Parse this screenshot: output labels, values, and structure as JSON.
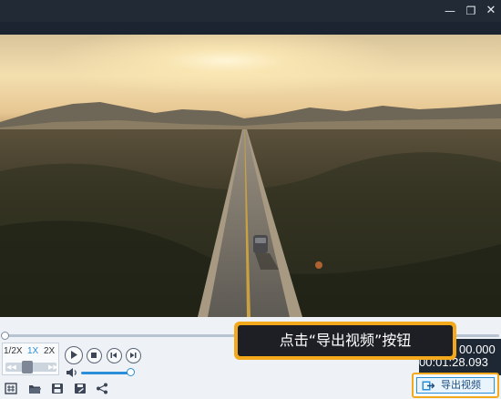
{
  "window": {
    "min_glyph": "—",
    "max_glyph": "❐",
    "close_glyph": "✕"
  },
  "playback": {
    "speed_options": [
      "1/2X",
      "1X",
      "2X"
    ],
    "selected_speed": "1X",
    "speed_slower_glyph": "◀◀",
    "speed_faster_glyph": "▶▶",
    "current_time": "00.000",
    "total_time": "00:01:28.093",
    "progress": 0.0,
    "volume": 0.9
  },
  "tooltip": {
    "text": "点击“导出视频”按钮"
  },
  "export": {
    "label": "导出视频"
  },
  "colors": {
    "accent": "#2a8fd8",
    "highlight": "#f4a81c",
    "panel": "#eef1f5",
    "titlebar": "#222a36"
  },
  "icons": [
    "minimize-icon",
    "maximize-icon",
    "close-icon",
    "play-icon",
    "stop-icon",
    "prev-frame-icon",
    "next-frame-icon",
    "volume-icon",
    "snapshot-icon",
    "open-folder-icon",
    "save-icon",
    "save-as-icon",
    "share-icon",
    "export-icon"
  ]
}
